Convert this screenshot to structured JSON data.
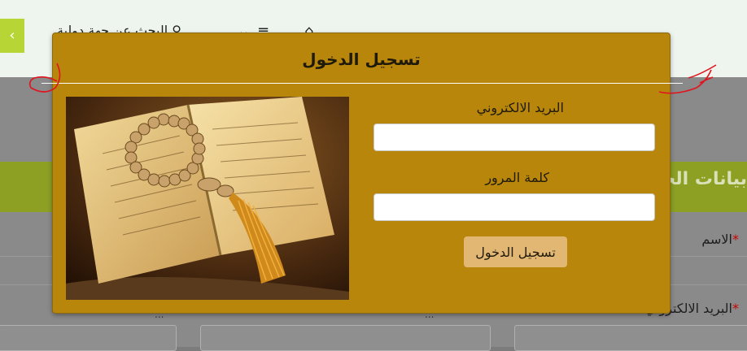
{
  "header": {
    "side_button": "‹",
    "search_label": "البحث عن جهة دولية",
    "icons": [
      "search-icon",
      "chevron-down-icon",
      "menu-icon",
      "home-icon"
    ]
  },
  "background": {
    "section_title": "بيانات الحساب",
    "field_1_label": "الاسم",
    "field_2_label": "البريد الالكتروني",
    "required_mark": "*",
    "hint": "..."
  },
  "modal": {
    "title": "تسجيل الدخول",
    "email_label": "البريد الالكتروني",
    "email_value": "",
    "password_label": "كلمة المرور",
    "password_value": "",
    "submit_label": "تسجيل الدخول",
    "image_alt": "quran-with-prayer-beads-image"
  },
  "colors": {
    "modal_bg": "#b8860b",
    "button_bg": "#e2b673",
    "lime": "#b7d534",
    "band_green": "#8da024",
    "annotation_red": "#e0141e"
  }
}
